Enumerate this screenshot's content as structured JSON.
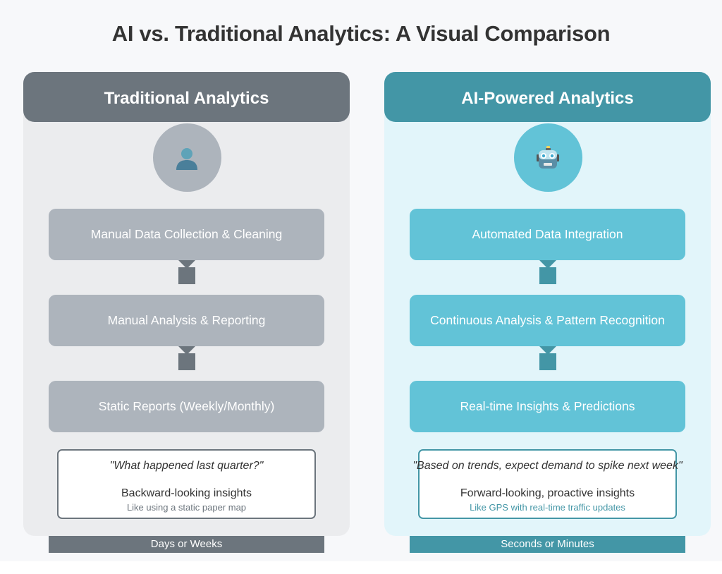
{
  "title": "AI vs. Traditional Analytics: A Visual Comparison",
  "colors": {
    "traditional_accent": "#6c757d",
    "traditional_light": "#adb4bc",
    "traditional_bg": "#ebecee",
    "ai_accent": "#4396a6",
    "ai_light": "#62c3d7",
    "ai_bg": "#e2f5fa"
  },
  "traditional": {
    "header": "Traditional Analytics",
    "icon": "person-silhouette-icon",
    "icon_glyph": "👤",
    "steps": [
      "Manual Data Collection & Cleaning",
      "Manual Analysis & Reporting",
      "Static Reports (Weekly/Monthly)"
    ],
    "insight": {
      "quote": "\"What happened last quarter?\"",
      "main": "Backward-looking insights",
      "sub": "Like using a static paper map"
    },
    "timeframe": "Days or Weeks"
  },
  "ai": {
    "header": "AI-Powered Analytics",
    "icon": "robot-icon",
    "icon_glyph": "🤖",
    "steps": [
      "Automated Data Integration",
      "Continuous Analysis & Pattern Recognition",
      "Real-time Insights & Predictions"
    ],
    "insight": {
      "quote": "\"Based on trends, expect demand to spike next week\"",
      "main": "Forward-looking, proactive insights",
      "sub": "Like GPS with real-time traffic updates"
    },
    "timeframe": "Seconds or Minutes"
  }
}
